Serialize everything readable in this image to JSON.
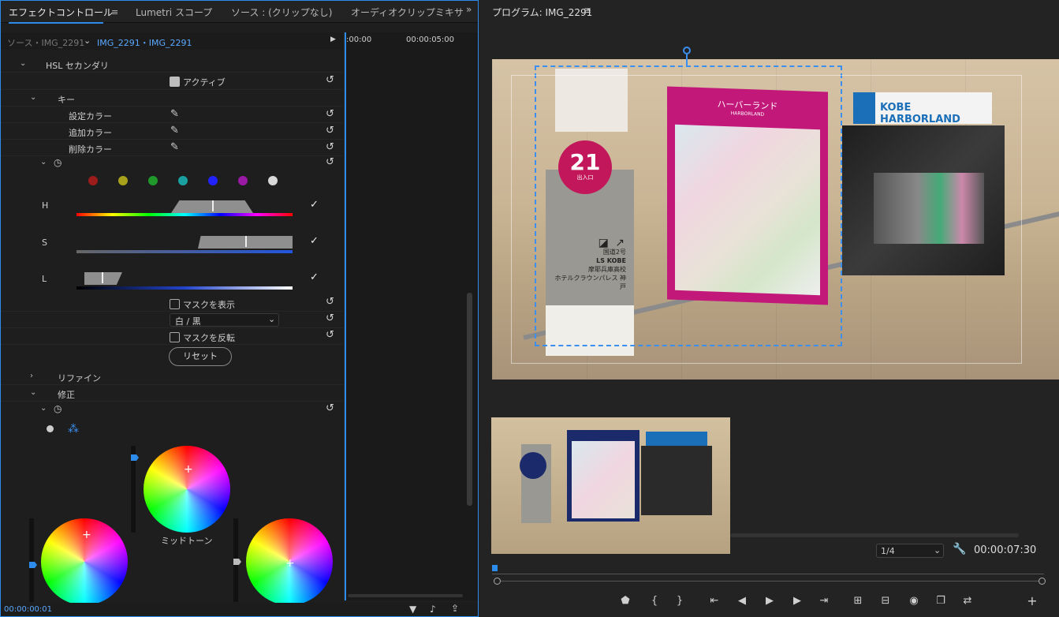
{
  "left_tabs": [
    "エフェクトコントロール",
    "Lumetri スコープ",
    "ソース : (クリップなし)",
    "オーディオクリップミキサ"
  ],
  "source_row": {
    "source": "ソース・IMG_2291",
    "clip": "IMG_2291・IMG_2291"
  },
  "timeline": {
    "start": ":00:00",
    "end": "00:00:05:00"
  },
  "effect": {
    "hsl": "HSL セカンダリ",
    "active": "アクティブ",
    "key": "キー",
    "set_color": "設定カラー",
    "add_color": "追加カラー",
    "remove_color": "削除カラー",
    "h": "H",
    "s": "S",
    "l": "L",
    "show_mask": "マスクを表示",
    "mask_mode": "白 / 黒",
    "invert_mask": "マスクを反転",
    "reset": "リセット",
    "refine": "リファイン",
    "correction": "修正",
    "midtone": "ミッドトーン"
  },
  "colors": [
    "#9c1c1c",
    "#a8a11a",
    "#1f9a2a",
    "#1aa0a0",
    "#2222ff",
    "#9a1aa6",
    "#d8d8d8"
  ],
  "current_time": "00:00:00:01",
  "program": {
    "title": "プログラム: IMG_2291",
    "zoom": "1/4",
    "timecode": "00:00:07:30"
  },
  "sign": {
    "number": "21",
    "sub": "出入口",
    "route": "国道2号",
    "ls": "LS KOBE",
    "school": "摩耶兵庫高校",
    "hotel": "ホテルクラウンパレス 神戸",
    "harbor_jp": "ハーバーランド",
    "harbor_en": "HARBORLAND",
    "kobe": "KOBE HARBORLAND"
  },
  "accent": "#2d8ceb"
}
